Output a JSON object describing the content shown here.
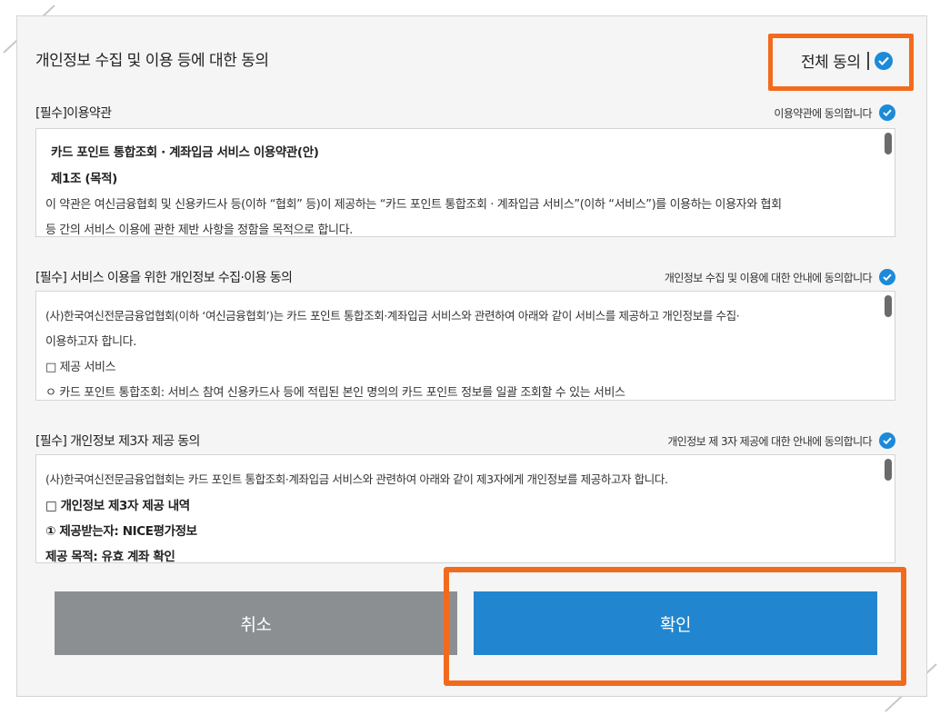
{
  "dialog": {
    "title": "개인정보 수집 및 이용 등에 대한 동의",
    "all_agree_label": "전체 동의"
  },
  "sections": [
    {
      "title": "[필수]이용약관",
      "agree_label": "이용약관에 동의합니다",
      "lines": [
        "카드 포인트 통합조회 · 계좌입금 서비스 이용약관(안)",
        "제1조 (목적)",
        "이 약관은 여신금융협회 및 신용카드사 등(이하 “협회” 등)이 제공하는 “카드 포인트 통합조회 · 계좌입금 서비스”(이하 “서비스”)를 이용하는 이용자와 협회",
        "등 간의 서비스 이용에 관한 제반 사항을 정함을 목적으로 합니다."
      ]
    },
    {
      "title": "[필수] 서비스 이용을 위한 개인정보 수집·이용 동의",
      "agree_label": "개인정보 수집 및 이용에 대한 안내에 동의합니다",
      "lines": [
        "(사)한국여신전문금융업협회(이하 ‘여신금융협회’)는 카드 포인트 통합조회·계좌입금 서비스와 관련하여 아래와 같이 서비스를 제공하고 개인정보를 수집·",
        "이용하고자 합니다.",
        "□ 제공 서비스",
        "ㅇ 카드 포인트 통합조회: 서비스 참여 신용카드사 등에 적립된 본인 명의의 카드 포인트 정보를 일괄 조회할 수 있는 서비스"
      ]
    },
    {
      "title": "[필수] 개인정보 제3자 제공 동의",
      "agree_label": "개인정보 제 3자 제공에 대한 안내에 동의합니다",
      "lines": [
        "(사)한국여신전문금융업협회는 카드 포인트 통합조회·계좌입금 서비스와 관련하여 아래와 같이 제3자에게 개인정보를 제공하고자 합니다.",
        "□ 개인정보 제3자 제공 내역",
        "① 제공받는자: NICE평가정보",
        "제공 목적: 유효 계좌 확인"
      ]
    }
  ],
  "buttons": {
    "cancel": "취소",
    "confirm": "확인"
  },
  "colors": {
    "accent_blue": "#2186cf",
    "check_blue": "#1c8ad8",
    "highlight_orange": "#f26b1d",
    "cancel_gray": "#8c8f92"
  }
}
